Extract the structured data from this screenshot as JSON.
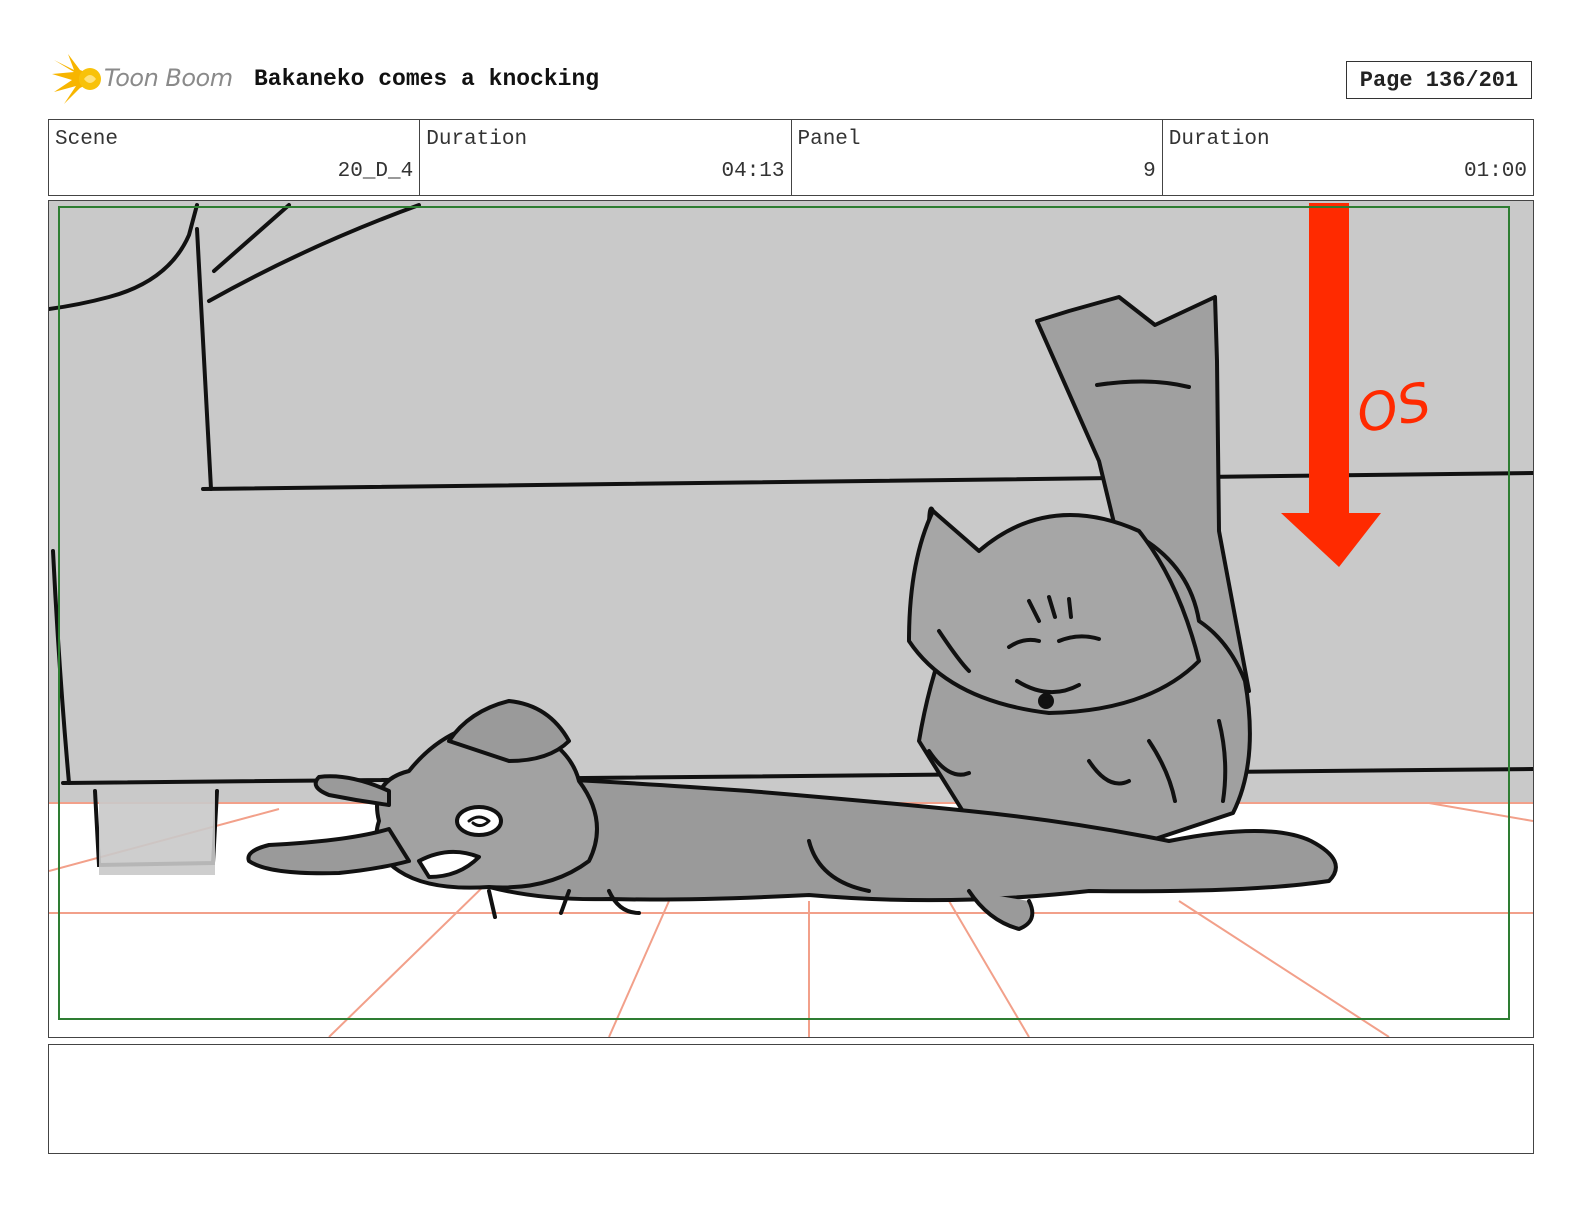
{
  "header": {
    "logo_text": "Toon Boom",
    "title": "Bakaneko comes a knocking",
    "page_label": "Page 136/201"
  },
  "info": {
    "scene_label": "Scene",
    "scene_value": "20_D_4",
    "duration_label": "Duration",
    "duration_value": "04:13",
    "panel_label": "Panel",
    "panel_value": "9",
    "panel_duration_label": "Duration",
    "panel_duration_value": "01:00"
  },
  "panel": {
    "annotation": "OS",
    "colors": {
      "wall": "#c9c9c9",
      "character": "#9e9e9e",
      "arrow": "#ff2a00",
      "floor_lines": "#f2a08a",
      "safe_frame": "#2e7d32"
    }
  },
  "notes": {
    "text": ""
  }
}
